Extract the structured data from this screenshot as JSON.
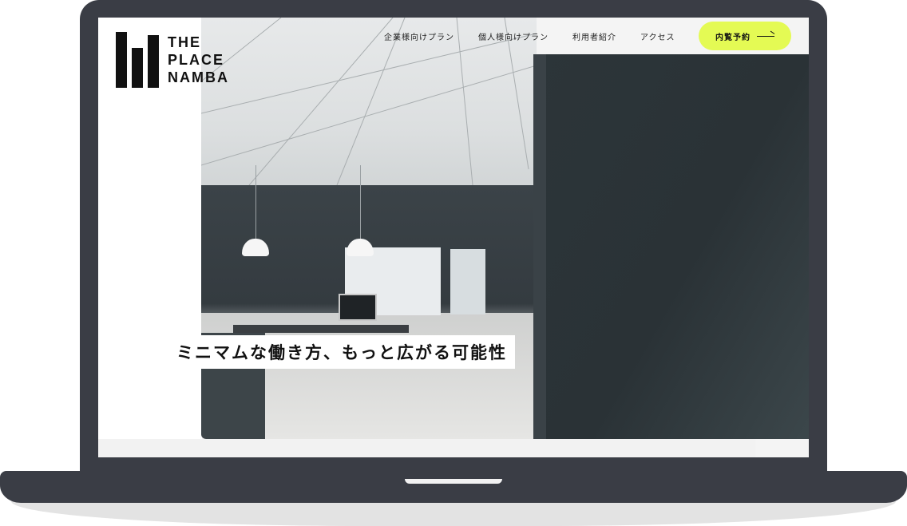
{
  "brand": {
    "line1": "THE",
    "line2": "PLACE",
    "line3": "NAMBA",
    "logo_color": "#111111"
  },
  "nav": {
    "items": [
      {
        "label": "企業様向けプラン"
      },
      {
        "label": "個人様向けプラン"
      },
      {
        "label": "利用者紹介"
      },
      {
        "label": "アクセス"
      }
    ],
    "cta_label": "内覧予約",
    "cta_icon": "arrow-right-icon",
    "cta_color": "#e4fa54"
  },
  "hero": {
    "tagline": "ミニマムな働き方、もっと広がる可能性"
  },
  "colors": {
    "device": "#3a3d45",
    "wall": "#2c3539"
  }
}
